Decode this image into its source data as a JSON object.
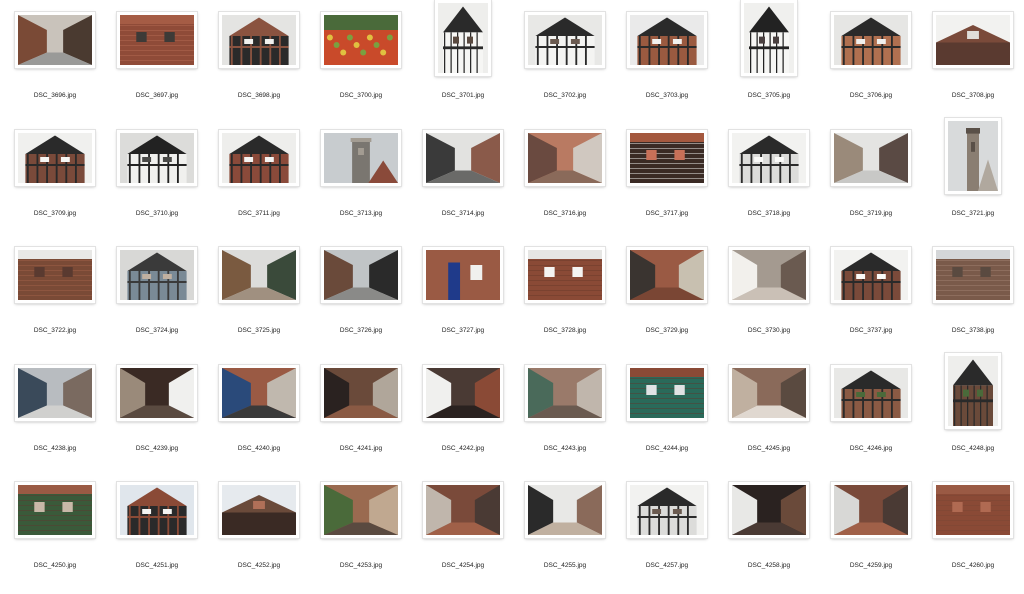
{
  "rows": [
    [
      {
        "name": "DSC_3696.jpg",
        "orientation": "landscape",
        "palette": [
          "#c9c3bb",
          "#7a4a36",
          "#4a3a30",
          "#9a9a98"
        ],
        "scene": "street"
      },
      {
        "name": "DSC_3697.jpg",
        "orientation": "landscape",
        "palette": [
          "#a55c45",
          "#8f4b38",
          "#3d3a37",
          "#b46a52"
        ],
        "scene": "brick"
      },
      {
        "name": "DSC_3698.jpg",
        "orientation": "landscape",
        "palette": [
          "#e4e4e2",
          "#8a5340",
          "#2a2a2a",
          "#f0f0ee"
        ],
        "scene": "tudor"
      },
      {
        "name": "DSC_3700.jpg",
        "orientation": "landscape",
        "palette": [
          "#4a6a3a",
          "#c94a2a",
          "#7aa040",
          "#e0c040"
        ],
        "scene": "market"
      },
      {
        "name": "DSC_3701.jpg",
        "orientation": "portrait",
        "palette": [
          "#eeeeec",
          "#2a2a2a",
          "#f6f6f4",
          "#5a4a40"
        ],
        "scene": "tudor"
      },
      {
        "name": "DSC_3702.jpg",
        "orientation": "landscape",
        "palette": [
          "#e8e8e6",
          "#2a2a2a",
          "#f4f4f2",
          "#6a5a50"
        ],
        "scene": "tudor"
      },
      {
        "name": "DSC_3703.jpg",
        "orientation": "landscape",
        "palette": [
          "#eaeaea",
          "#2a2a2a",
          "#9a5a40",
          "#f2f2f0"
        ],
        "scene": "tudor"
      },
      {
        "name": "DSC_3705.jpg",
        "orientation": "portrait",
        "palette": [
          "#f0f0ee",
          "#222222",
          "#f6f6f4",
          "#4a4040"
        ],
        "scene": "tudor"
      },
      {
        "name": "DSC_3706.jpg",
        "orientation": "landscape",
        "palette": [
          "#e6e6e4",
          "#2a2a2a",
          "#b07050",
          "#f0f0ee"
        ],
        "scene": "tudor"
      },
      {
        "name": "DSC_3708.jpg",
        "orientation": "landscape",
        "palette": [
          "#f2f2f0",
          "#7a4a3a",
          "#5a3a30",
          "#e0ddd8"
        ],
        "scene": "roof"
      }
    ],
    [
      {
        "name": "DSC_3709.jpg",
        "orientation": "landscape",
        "palette": [
          "#f0f0ee",
          "#2a2a2a",
          "#7a4a3a",
          "#f6f6f4"
        ],
        "scene": "tudor"
      },
      {
        "name": "DSC_3710.jpg",
        "orientation": "landscape",
        "palette": [
          "#dcdcda",
          "#222222",
          "#f0f0ee",
          "#4a4a48"
        ],
        "scene": "tudor"
      },
      {
        "name": "DSC_3711.jpg",
        "orientation": "landscape",
        "palette": [
          "#eeeeec",
          "#2a2a2a",
          "#8a4a3a",
          "#f4f4f2"
        ],
        "scene": "tudor"
      },
      {
        "name": "DSC_3713.jpg",
        "orientation": "landscape",
        "palette": [
          "#c8cccf",
          "#7a7670",
          "#a39c92",
          "#8a4a3a"
        ],
        "scene": "church"
      },
      {
        "name": "DSC_3714.jpg",
        "orientation": "landscape",
        "palette": [
          "#e2e2e0",
          "#3a3a3a",
          "#8a5a4a",
          "#6a6a68"
        ],
        "scene": "street"
      },
      {
        "name": "DSC_3716.jpg",
        "orientation": "landscape",
        "palette": [
          "#b97a62",
          "#6a4a40",
          "#d0c8c0",
          "#8a6a5a"
        ],
        "scene": "street"
      },
      {
        "name": "DSC_3717.jpg",
        "orientation": "landscape",
        "palette": [
          "#a4583e",
          "#3a2a24",
          "#c87058",
          "#eeeeec"
        ],
        "scene": "brick"
      },
      {
        "name": "DSC_3718.jpg",
        "orientation": "landscape",
        "palette": [
          "#f2f2f0",
          "#2a2a2a",
          "#dcdcda",
          "#fafaf8"
        ],
        "scene": "tudor"
      },
      {
        "name": "DSC_3719.jpg",
        "orientation": "landscape",
        "palette": [
          "#e4e4e2",
          "#9a8a7a",
          "#5a4a44",
          "#c8c8c6"
        ],
        "scene": "street"
      },
      {
        "name": "DSC_3721.jpg",
        "orientation": "portrait",
        "palette": [
          "#d8dadb",
          "#8a7e72",
          "#5a5048",
          "#b0a89e"
        ],
        "scene": "church"
      }
    ],
    [
      {
        "name": "DSC_3722.jpg",
        "orientation": "landscape",
        "palette": [
          "#e8e8e6",
          "#7a4a36",
          "#5a3a30",
          "#a06048"
        ],
        "scene": "brick"
      },
      {
        "name": "DSC_3724.jpg",
        "orientation": "landscape",
        "palette": [
          "#d8d8d6",
          "#3a3a3a",
          "#7a8a96",
          "#c0b0a0"
        ],
        "scene": "tudor"
      },
      {
        "name": "DSC_3725.jpg",
        "orientation": "landscape",
        "palette": [
          "#dcdcda",
          "#7a5a40",
          "#3a4a3a",
          "#a09080"
        ],
        "scene": "street"
      },
      {
        "name": "DSC_3726.jpg",
        "orientation": "landscape",
        "palette": [
          "#c0c4c6",
          "#6a4a3a",
          "#2a2a2a",
          "#8a8a88"
        ],
        "scene": "street"
      },
      {
        "name": "DSC_3727.jpg",
        "orientation": "landscape",
        "palette": [
          "#9a5a44",
          "#1f3a8a",
          "#f0f0ee",
          "#7a4634"
        ],
        "scene": "door"
      },
      {
        "name": "DSC_3728.jpg",
        "orientation": "landscape",
        "palette": [
          "#e6e6e4",
          "#8a4a36",
          "#f4f4f2",
          "#6a3a2a"
        ],
        "scene": "brick"
      },
      {
        "name": "DSC_3729.jpg",
        "orientation": "landscape",
        "palette": [
          "#9a5a44",
          "#3a3430",
          "#c8c0b0",
          "#7a4634"
        ],
        "scene": "alley"
      },
      {
        "name": "DSC_3730.jpg",
        "orientation": "landscape",
        "palette": [
          "#a49a90",
          "#f2f0ec",
          "#6a5a50",
          "#cac0b6"
        ],
        "scene": "alley"
      },
      {
        "name": "DSC_3737.jpg",
        "orientation": "landscape",
        "palette": [
          "#f2f2f0",
          "#2a2a2a",
          "#7a4a3a",
          "#fafaf8"
        ],
        "scene": "tudor"
      },
      {
        "name": "DSC_3738.jpg",
        "orientation": "landscape",
        "palette": [
          "#d4d6d8",
          "#7a5a4a",
          "#5a4a40",
          "#a08070"
        ],
        "scene": "brick"
      }
    ],
    [
      {
        "name": "DSC_4238.jpg",
        "orientation": "landscape",
        "palette": [
          "#b8bcc0",
          "#3a4a5a",
          "#7a6a60",
          "#d0d0ce"
        ],
        "scene": "street"
      },
      {
        "name": "DSC_4239.jpg",
        "orientation": "landscape",
        "palette": [
          "#3a2a24",
          "#9a8a7a",
          "#f0f0ee",
          "#5a4a40"
        ],
        "scene": "alley"
      },
      {
        "name": "DSC_4240.jpg",
        "orientation": "landscape",
        "palette": [
          "#9a5a44",
          "#2a4a7a",
          "#c0b8ae",
          "#3a3a3a"
        ],
        "scene": "street"
      },
      {
        "name": "DSC_4241.jpg",
        "orientation": "landscape",
        "palette": [
          "#6a4a3a",
          "#2a2220",
          "#b0a69a",
          "#8a5a44"
        ],
        "scene": "alley"
      },
      {
        "name": "DSC_4242.jpg",
        "orientation": "landscape",
        "palette": [
          "#4a3a34",
          "#f0f0ee",
          "#8a4a36",
          "#2a2220"
        ],
        "scene": "alley"
      },
      {
        "name": "DSC_4243.jpg",
        "orientation": "landscape",
        "palette": [
          "#9a7a6a",
          "#4a6a5a",
          "#c0b6ac",
          "#6a5a50"
        ],
        "scene": "alley"
      },
      {
        "name": "DSC_4244.jpg",
        "orientation": "landscape",
        "palette": [
          "#8a4a36",
          "#2a6a5a",
          "#e0e2e4",
          "#5a3a30"
        ],
        "scene": "brick"
      },
      {
        "name": "DSC_4245.jpg",
        "orientation": "landscape",
        "palette": [
          "#8a6a5a",
          "#c0b0a0",
          "#5a4a40",
          "#e0d8d0"
        ],
        "scene": "alley"
      },
      {
        "name": "DSC_4246.jpg",
        "orientation": "landscape",
        "palette": [
          "#e8e8e6",
          "#2a2a2a",
          "#8a5a44",
          "#4a6a3a"
        ],
        "scene": "tudor"
      },
      {
        "name": "DSC_4248.jpg",
        "orientation": "portrait",
        "palette": [
          "#eeeeec",
          "#2a2a2a",
          "#6a4a3a",
          "#4a6a3a"
        ],
        "scene": "tudor"
      }
    ],
    [
      {
        "name": "DSC_4250.jpg",
        "orientation": "landscape",
        "palette": [
          "#9a5a44",
          "#3a5a3a",
          "#c8b8a8",
          "#5a3a30"
        ],
        "scene": "brick"
      },
      {
        "name": "DSC_4251.jpg",
        "orientation": "landscape",
        "palette": [
          "#e0e6ec",
          "#8a4a36",
          "#2a2a2a",
          "#f4f4f2"
        ],
        "scene": "tudor"
      },
      {
        "name": "DSC_4252.jpg",
        "orientation": "landscape",
        "palette": [
          "#e6eaee",
          "#6a4a3a",
          "#3a2a24",
          "#b07058"
        ],
        "scene": "roof"
      },
      {
        "name": "DSC_4253.jpg",
        "orientation": "landscape",
        "palette": [
          "#9a6a50",
          "#4a6a3a",
          "#c0a890",
          "#5a4a40"
        ],
        "scene": "street"
      },
      {
        "name": "DSC_4254.jpg",
        "orientation": "landscape",
        "palette": [
          "#7a4a3a",
          "#c0b6ac",
          "#4a3a34",
          "#a06048"
        ],
        "scene": "alley"
      },
      {
        "name": "DSC_4255.jpg",
        "orientation": "landscape",
        "palette": [
          "#e8e8e6",
          "#2a2a2a",
          "#8a6a5a",
          "#c0b0a0"
        ],
        "scene": "alley"
      },
      {
        "name": "DSC_4257.jpg",
        "orientation": "landscape",
        "palette": [
          "#f2f2f0",
          "#2a2a2a",
          "#dcdcda",
          "#6a5a50"
        ],
        "scene": "tudor"
      },
      {
        "name": "DSC_4258.jpg",
        "orientation": "landscape",
        "palette": [
          "#2a2220",
          "#e8e8e6",
          "#6a4a3a",
          "#4a3a34"
        ],
        "scene": "alley"
      },
      {
        "name": "DSC_4259.jpg",
        "orientation": "landscape",
        "palette": [
          "#7a4a3a",
          "#d8d8d6",
          "#4a3a34",
          "#a06048"
        ],
        "scene": "alley"
      },
      {
        "name": "DSC_4260.jpg",
        "orientation": "landscape",
        "palette": [
          "#9a5a44",
          "#8a4a36",
          "#b06a52",
          "#7a4634"
        ],
        "scene": "brick"
      }
    ]
  ]
}
